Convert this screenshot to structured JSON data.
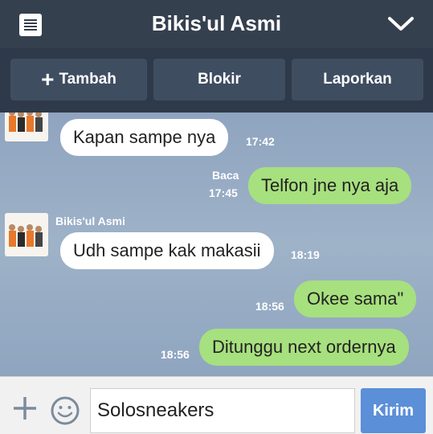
{
  "header": {
    "title": "Bikis'ul Asmi",
    "menu_icon": "menu-icon",
    "collapse_icon": "chevron-down-icon"
  },
  "actions": {
    "add": "Tambah",
    "block": "Blokir",
    "report": "Laporkan"
  },
  "messages": [
    {
      "direction": "in",
      "text": "Kapan sampe nya",
      "time": "17:42"
    },
    {
      "direction": "out",
      "text": "Telfon jne nya aja",
      "time": "17:45",
      "read": "Baca"
    },
    {
      "direction": "in",
      "sender": "Bikis'ul Asmi",
      "text": "Udh sampe kak makasii",
      "time": "18:19"
    },
    {
      "direction": "out",
      "text": "Okee sama\"",
      "time": "18:56"
    },
    {
      "direction": "out",
      "text": "Ditunggu next ordernya",
      "time": "18:56"
    }
  ],
  "composer": {
    "value": "Solosneakers",
    "send_label": "Kirim"
  },
  "colors": {
    "header": "#35404f",
    "incoming_bubble": "#ffffff",
    "outgoing_bubble": "#a7e07e",
    "send_button": "#5b8fd8"
  }
}
